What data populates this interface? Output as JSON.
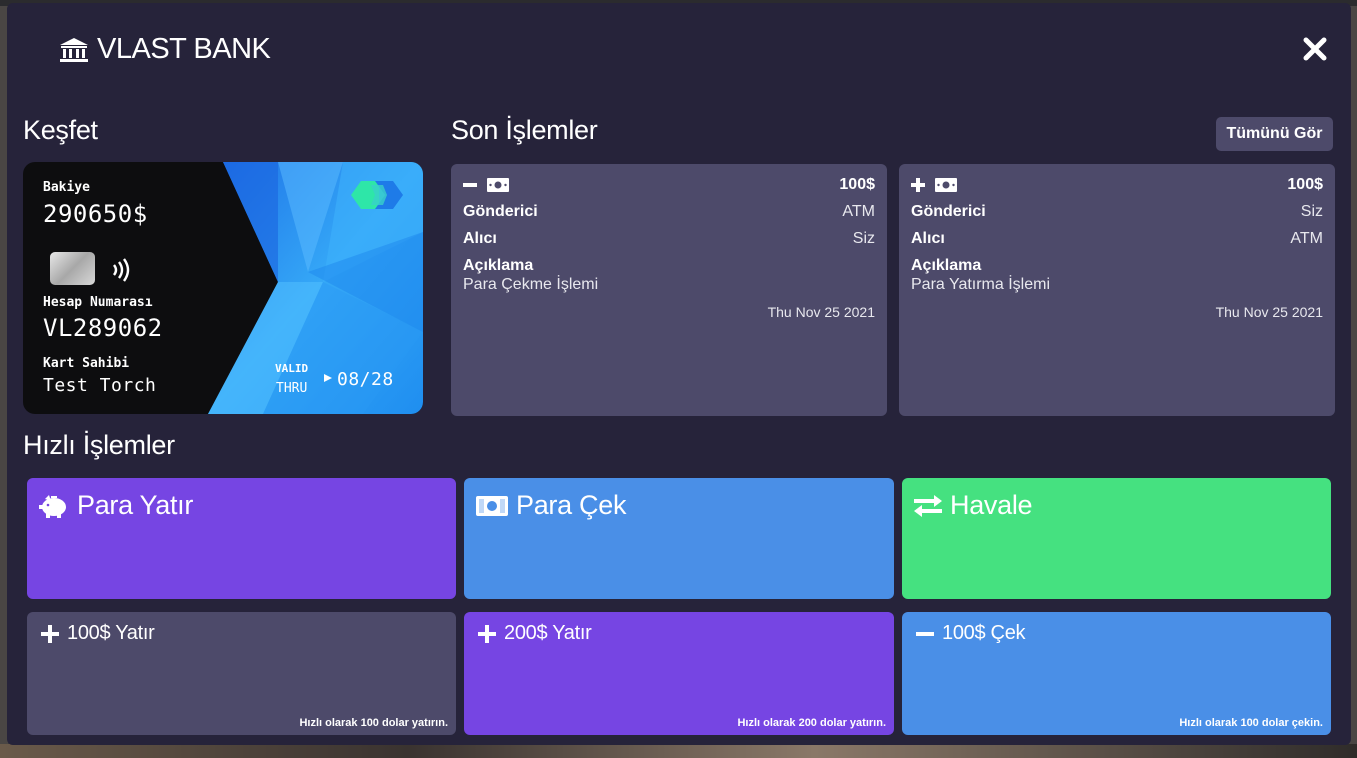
{
  "app": {
    "title": "VLAST BANK"
  },
  "sections": {
    "discover": "Keşfet",
    "recent": "Son İşlemler",
    "quick": "Hızlı İşlemler"
  },
  "card": {
    "balance_label": "Bakiye",
    "balance": "290650$",
    "account_label": "Hesap Numarası",
    "account_number": "VL289062",
    "holder_label": "Kart Sahibi",
    "holder_name": "Test Torch",
    "valid_label": "VALID",
    "thru_label": "THRU",
    "expiry": "08/28",
    "colors": {
      "blue": "#2f9df5",
      "dark": "#0d0d0f"
    }
  },
  "recent": {
    "view_all_label": "Tümünü Gör",
    "transactions": [
      {
        "sign_icon": "minus-icon",
        "amount": "100$",
        "sender_label": "Gönderici",
        "sender": "ATM",
        "receiver_label": "Alıcı",
        "receiver": "Siz",
        "desc_label": "Açıklama",
        "description": "Para Çekme İşlemi",
        "date": "Thu Nov 25 2021"
      },
      {
        "sign_icon": "plus-icon",
        "amount": "100$",
        "sender_label": "Gönderici",
        "sender": "Siz",
        "receiver_label": "Alıcı",
        "receiver": "ATM",
        "desc_label": "Açıklama",
        "description": "Para Yatırma İşlemi",
        "date": "Thu Nov 25 2021"
      }
    ]
  },
  "quick_actions": {
    "main": [
      {
        "icon": "piggy-bank-icon",
        "label": "Para Yatır",
        "color": "#7645e3"
      },
      {
        "icon": "money-bill-icon",
        "label": "Para Çek",
        "color": "#4a8fe7"
      },
      {
        "icon": "exchange-icon",
        "label": "Havale",
        "color": "#45e180"
      }
    ],
    "preset": [
      {
        "icon": "plus-icon",
        "label": "100$ Yatır",
        "hint": "Hızlı olarak 100 dolar yatırın.",
        "color": "#4d4a6a"
      },
      {
        "icon": "plus-icon",
        "label": "200$ Yatır",
        "hint": "Hızlı olarak 200 dolar yatırın.",
        "color": "#7645e3"
      },
      {
        "icon": "minus-icon",
        "label": "100$ Çek",
        "hint": "Hızlı olarak 100 dolar çekin.",
        "color": "#4a8fe7"
      }
    ]
  },
  "colors": {
    "panel": "#26233a",
    "tile": "#4d4a6a"
  }
}
